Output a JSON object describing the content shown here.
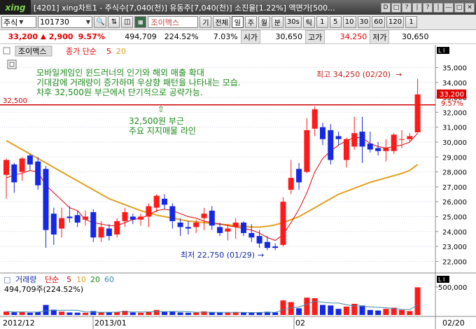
{
  "titlebar": {
    "logo": "xing",
    "title": "[4201] xing차트1 - 주식수[7,040(천)] 유동주[7,040(천)] 소진율[1.22%] 액면가[500...",
    "buttons": [
      "D",
      "□",
      "?",
      "|",
      "?",
      "|",
      "—",
      "□",
      "✕"
    ]
  },
  "toolbar": {
    "market": "주식",
    "code": "101730",
    "name": "조이맥스",
    "btn_gi": "기",
    "btn_all": "전체",
    "periods": [
      "일",
      "주",
      "월",
      "분",
      "30s",
      "틱"
    ],
    "intervals": [
      "1",
      "5",
      "10",
      "30",
      "60",
      "120",
      "1"
    ]
  },
  "price": {
    "current": "33,200",
    "arrow": "▲",
    "change": "2,900",
    "change_pct": "9.57%",
    "volume": "494,709",
    "vol_ratio": "224.52%",
    "turnover": "7.03%",
    "open_label": "시가",
    "open": "30,650",
    "high_label": "고가",
    "high": "34,250",
    "low_label": "저가",
    "low": "30,650"
  },
  "legend": {
    "name": "조이맥스",
    "ma_label": "종가 단순",
    "ma1": "5",
    "ma2": "20"
  },
  "annotations": {
    "line1": "모바일게임인 윈드러너의 인기와 해외 매출 확대",
    "line2": "기대감에 거래량이 증가하며 우상향 패턴을 나타내는 모습.",
    "line3": "차후 32,500원 부근에서 단기적으로 공략가능.",
    "support_1": "32,500원 부근",
    "support_2": "주요 지지매물 라인",
    "hline_label": "32,500",
    "high_note": "최고 34,250 (02/20)",
    "low_note": "최저 22,750 (01/29)",
    "current_tag": "33,200",
    "pct_tag": "9.57%"
  },
  "volume_legend": {
    "title": "거래량",
    "ma_label": "단순",
    "ma1": "5",
    "ma2": "10",
    "ma3": "20",
    "ma4": "60",
    "value": "494,709주(224.52%)",
    "axis_label": "500,000"
  },
  "x_labels": [
    "2012/12",
    "2013/01",
    "02",
    "02/20"
  ],
  "colors": {
    "up": "#ff1a1a",
    "down": "#1428e6",
    "ma5": "#e00000",
    "ma20": "#e0a020",
    "hline": "#d00000"
  },
  "chart_data": {
    "type": "candlestick",
    "y_axis": [
      35000,
      34000,
      33000,
      32000,
      31000,
      30000,
      29000,
      28000,
      27000,
      26000,
      25000,
      24000,
      23000,
      22000
    ],
    "ylim": [
      21500,
      35400
    ],
    "candles": [
      {
        "o": 27800,
        "h": 28900,
        "l": 26200,
        "c": 28800
      },
      {
        "o": 28500,
        "h": 28600,
        "l": 26600,
        "c": 27300
      },
      {
        "o": 28000,
        "h": 29000,
        "l": 27400,
        "c": 28900
      },
      {
        "o": 29100,
        "h": 29200,
        "l": 28100,
        "c": 28500
      },
      {
        "o": 28700,
        "h": 29000,
        "l": 26800,
        "c": 27100
      },
      {
        "o": 28200,
        "h": 28400,
        "l": 22900,
        "c": 24100
      },
      {
        "o": 25200,
        "h": 25600,
        "l": 23100,
        "c": 23800
      },
      {
        "o": 24200,
        "h": 25600,
        "l": 23600,
        "c": 24900
      },
      {
        "o": 25000,
        "h": 25700,
        "l": 24600,
        "c": 24900
      },
      {
        "o": 25100,
        "h": 25400,
        "l": 24300,
        "c": 24600
      },
      {
        "o": 24800,
        "h": 25400,
        "l": 24400,
        "c": 25000
      },
      {
        "o": 25300,
        "h": 25500,
        "l": 23300,
        "c": 23600
      },
      {
        "o": 23600,
        "h": 24700,
        "l": 23300,
        "c": 24300
      },
      {
        "o": 24200,
        "h": 24500,
        "l": 23400,
        "c": 23700
      },
      {
        "o": 23800,
        "h": 24900,
        "l": 23600,
        "c": 24700
      },
      {
        "o": 24700,
        "h": 25600,
        "l": 24300,
        "c": 25300
      },
      {
        "o": 25000,
        "h": 25200,
        "l": 24500,
        "c": 24800
      },
      {
        "o": 24800,
        "h": 25200,
        "l": 24400,
        "c": 25000
      },
      {
        "o": 25000,
        "h": 25900,
        "l": 24300,
        "c": 25700
      },
      {
        "o": 25600,
        "h": 26500,
        "l": 25300,
        "c": 26400
      },
      {
        "o": 26200,
        "h": 26500,
        "l": 25500,
        "c": 25800
      },
      {
        "o": 25700,
        "h": 25900,
        "l": 24200,
        "c": 24700
      },
      {
        "o": 24600,
        "h": 24900,
        "l": 23700,
        "c": 24300
      },
      {
        "o": 24300,
        "h": 24700,
        "l": 23800,
        "c": 24200
      },
      {
        "o": 24300,
        "h": 24800,
        "l": 23900,
        "c": 24600
      },
      {
        "o": 24900,
        "h": 25600,
        "l": 24100,
        "c": 25200
      },
      {
        "o": 25400,
        "h": 25700,
        "l": 24100,
        "c": 24400
      },
      {
        "o": 24300,
        "h": 24600,
        "l": 23700,
        "c": 23900
      },
      {
        "o": 24000,
        "h": 24500,
        "l": 23400,
        "c": 24200
      },
      {
        "o": 24300,
        "h": 24900,
        "l": 23500,
        "c": 24600
      },
      {
        "o": 24600,
        "h": 24700,
        "l": 23700,
        "c": 23900
      },
      {
        "o": 23900,
        "h": 24500,
        "l": 23300,
        "c": 23600
      },
      {
        "o": 23700,
        "h": 24100,
        "l": 22900,
        "c": 23200
      },
      {
        "o": 23300,
        "h": 23700,
        "l": 22750,
        "c": 22900
      },
      {
        "o": 23000,
        "h": 23200,
        "l": 22750,
        "c": 22900
      },
      {
        "o": 23100,
        "h": 26300,
        "l": 23000,
        "c": 26000
      },
      {
        "o": 26800,
        "h": 28800,
        "l": 26500,
        "c": 27600
      },
      {
        "o": 28200,
        "h": 28600,
        "l": 26800,
        "c": 27300
      },
      {
        "o": 28000,
        "h": 31600,
        "l": 27900,
        "c": 30800
      },
      {
        "o": 30900,
        "h": 32400,
        "l": 30400,
        "c": 32200
      },
      {
        "o": 31000,
        "h": 31300,
        "l": 29800,
        "c": 30200
      },
      {
        "o": 30800,
        "h": 31200,
        "l": 28500,
        "c": 28800
      },
      {
        "o": 30400,
        "h": 30700,
        "l": 29800,
        "c": 30200
      },
      {
        "o": 28800,
        "h": 30300,
        "l": 28300,
        "c": 30200
      },
      {
        "o": 29700,
        "h": 31700,
        "l": 29500,
        "c": 30600
      },
      {
        "o": 30700,
        "h": 31700,
        "l": 28600,
        "c": 29700
      },
      {
        "o": 29900,
        "h": 30700,
        "l": 29300,
        "c": 29500
      },
      {
        "o": 29600,
        "h": 30000,
        "l": 29100,
        "c": 29400
      },
      {
        "o": 29400,
        "h": 30200,
        "l": 28700,
        "c": 29600
      },
      {
        "o": 29400,
        "h": 30600,
        "l": 29200,
        "c": 30500
      },
      {
        "o": 30200,
        "h": 30800,
        "l": 29600,
        "c": 30200
      },
      {
        "o": 30200,
        "h": 30600,
        "l": 30000,
        "c": 30400
      },
      {
        "o": 30650,
        "h": 34250,
        "l": 30650,
        "c": 33200
      }
    ],
    "ma5": [
      27600,
      27800,
      27900,
      28100,
      28000,
      27100,
      26600,
      26100,
      25600,
      25400,
      24800,
      24600,
      24500,
      24400,
      24400,
      24600,
      24800,
      24900,
      25100,
      25400,
      25500,
      25400,
      25200,
      25000,
      24900,
      24700,
      24600,
      24500,
      24400,
      24300,
      24200,
      24100,
      23900,
      23600,
      23400,
      23800,
      24600,
      25500,
      26600,
      28000,
      28900,
      29400,
      29800,
      30100,
      30300,
      30300,
      29900,
      29700,
      29600,
      29700,
      29800,
      30000,
      30600
    ],
    "ma20": [
      30100,
      29800,
      29500,
      29200,
      28900,
      28600,
      28300,
      28000,
      27700,
      27400,
      27100,
      26800,
      26500,
      26200,
      26000,
      25800,
      25600,
      25400,
      25250,
      25100,
      25000,
      24900,
      24800,
      24700,
      24650,
      24600,
      24550,
      24500,
      24450,
      24400,
      24350,
      24300,
      24300,
      24350,
      24450,
      24600,
      24800,
      25000,
      25300,
      25600,
      25900,
      26200,
      26500,
      26700,
      26900,
      27100,
      27300,
      27450,
      27600,
      27750,
      27900,
      28100,
      28500
    ],
    "volume": [
      62000,
      48000,
      55000,
      40000,
      52000,
      180000,
      95000,
      60000,
      45000,
      42000,
      40000,
      70000,
      45000,
      48000,
      52000,
      75000,
      45000,
      40000,
      62000,
      90000,
      58000,
      60000,
      45000,
      40000,
      42000,
      65000,
      50000,
      42000,
      40000,
      48000,
      45000,
      42000,
      50000,
      58000,
      45000,
      260000,
      230000,
      120000,
      310000,
      300000,
      180000,
      170000,
      110000,
      150000,
      200000,
      170000,
      90000,
      80000,
      110000,
      130000,
      90000,
      70000,
      494709
    ]
  }
}
